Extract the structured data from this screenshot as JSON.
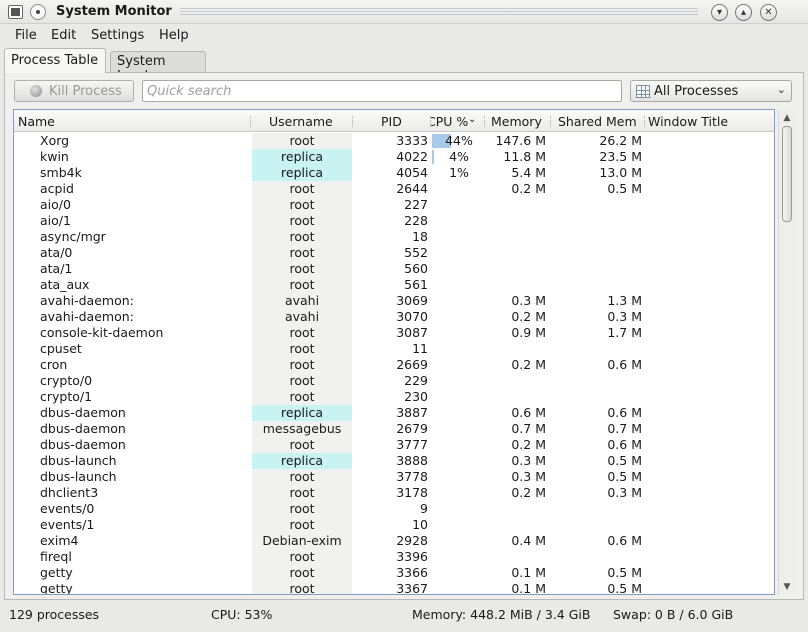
{
  "window": {
    "title": "System Monitor"
  },
  "menu": [
    "File",
    "Edit",
    "Settings",
    "Help"
  ],
  "tabs": {
    "active": "Process Table",
    "inactive": "System Load"
  },
  "toolbar": {
    "kill_label": "Kill Process",
    "search_placeholder": "Quick search",
    "filter_value": "All Processes"
  },
  "columns": {
    "name": "Name",
    "user": "Username",
    "pid": "PID",
    "cpu": "CPU %",
    "mem": "Memory",
    "shm": "Shared Mem",
    "title": "Window Title"
  },
  "processes": [
    {
      "name": "Xorg",
      "user": "root",
      "pid": "3333",
      "cpu": "44%",
      "cpu_value": 44,
      "mem": "147.6 M",
      "shm": "26.2 M",
      "hl": false
    },
    {
      "name": "kwin",
      "user": "replica",
      "pid": "4022",
      "cpu": "4%",
      "cpu_value": 4,
      "mem": "11.8 M",
      "shm": "23.5 M",
      "hl": true
    },
    {
      "name": "smb4k",
      "user": "replica",
      "pid": "4054",
      "cpu": "1%",
      "cpu_value": 1,
      "mem": "5.4 M",
      "shm": "13.0 M",
      "hl": true
    },
    {
      "name": "acpid",
      "user": "root",
      "pid": "2644",
      "cpu": "",
      "mem": "0.2 M",
      "shm": "0.5 M",
      "hl": false
    },
    {
      "name": "aio/0",
      "user": "root",
      "pid": "227",
      "cpu": "",
      "mem": "",
      "shm": "",
      "hl": false
    },
    {
      "name": "aio/1",
      "user": "root",
      "pid": "228",
      "cpu": "",
      "mem": "",
      "shm": "",
      "hl": false
    },
    {
      "name": "async/mgr",
      "user": "root",
      "pid": "18",
      "cpu": "",
      "mem": "",
      "shm": "",
      "hl": false
    },
    {
      "name": "ata/0",
      "user": "root",
      "pid": "552",
      "cpu": "",
      "mem": "",
      "shm": "",
      "hl": false
    },
    {
      "name": "ata/1",
      "user": "root",
      "pid": "560",
      "cpu": "",
      "mem": "",
      "shm": "",
      "hl": false
    },
    {
      "name": "ata_aux",
      "user": "root",
      "pid": "561",
      "cpu": "",
      "mem": "",
      "shm": "",
      "hl": false
    },
    {
      "name": "avahi-daemon:",
      "user": "avahi",
      "pid": "3069",
      "cpu": "",
      "mem": "0.3 M",
      "shm": "1.3 M",
      "hl": false
    },
    {
      "name": "avahi-daemon:",
      "user": "avahi",
      "pid": "3070",
      "cpu": "",
      "mem": "0.2 M",
      "shm": "0.3 M",
      "hl": false
    },
    {
      "name": "console-kit-daemon",
      "user": "root",
      "pid": "3087",
      "cpu": "",
      "mem": "0.9 M",
      "shm": "1.7 M",
      "hl": false
    },
    {
      "name": "cpuset",
      "user": "root",
      "pid": "11",
      "cpu": "",
      "mem": "",
      "shm": "",
      "hl": false
    },
    {
      "name": "cron",
      "user": "root",
      "pid": "2669",
      "cpu": "",
      "mem": "0.2 M",
      "shm": "0.6 M",
      "hl": false
    },
    {
      "name": "crypto/0",
      "user": "root",
      "pid": "229",
      "cpu": "",
      "mem": "",
      "shm": "",
      "hl": false
    },
    {
      "name": "crypto/1",
      "user": "root",
      "pid": "230",
      "cpu": "",
      "mem": "",
      "shm": "",
      "hl": false
    },
    {
      "name": "dbus-daemon",
      "user": "replica",
      "pid": "3887",
      "cpu": "",
      "mem": "0.6 M",
      "shm": "0.6 M",
      "hl": true
    },
    {
      "name": "dbus-daemon",
      "user": "messagebus",
      "pid": "2679",
      "cpu": "",
      "mem": "0.7 M",
      "shm": "0.7 M",
      "hl": false
    },
    {
      "name": "dbus-daemon",
      "user": "root",
      "pid": "3777",
      "cpu": "",
      "mem": "0.2 M",
      "shm": "0.6 M",
      "hl": false
    },
    {
      "name": "dbus-launch",
      "user": "replica",
      "pid": "3888",
      "cpu": "",
      "mem": "0.3 M",
      "shm": "0.5 M",
      "hl": true
    },
    {
      "name": "dbus-launch",
      "user": "root",
      "pid": "3778",
      "cpu": "",
      "mem": "0.3 M",
      "shm": "0.5 M",
      "hl": false
    },
    {
      "name": "dhclient3",
      "user": "root",
      "pid": "3178",
      "cpu": "",
      "mem": "0.2 M",
      "shm": "0.3 M",
      "hl": false
    },
    {
      "name": "events/0",
      "user": "root",
      "pid": "9",
      "cpu": "",
      "mem": "",
      "shm": "",
      "hl": false
    },
    {
      "name": "events/1",
      "user": "root",
      "pid": "10",
      "cpu": "",
      "mem": "",
      "shm": "",
      "hl": false
    },
    {
      "name": "exim4",
      "user": "Debian-exim",
      "pid": "2928",
      "cpu": "",
      "mem": "0.4 M",
      "shm": "0.6 M",
      "hl": false
    },
    {
      "name": "fireql",
      "user": "root",
      "pid": "3396",
      "cpu": "",
      "mem": "",
      "shm": "",
      "hl": false
    },
    {
      "name": "getty",
      "user": "root",
      "pid": "3366",
      "cpu": "",
      "mem": "0.1 M",
      "shm": "0.5 M",
      "hl": false
    },
    {
      "name": "getty",
      "user": "root",
      "pid": "3367",
      "cpu": "",
      "mem": "0.1 M",
      "shm": "0.5 M",
      "hl": false
    }
  ],
  "status": {
    "count": "129 processes",
    "cpu": "CPU: 53%",
    "memory": "Memory: 448.2 MiB / 3.4 GiB",
    "swap": "Swap: 0 B / 6.0 GiB"
  }
}
